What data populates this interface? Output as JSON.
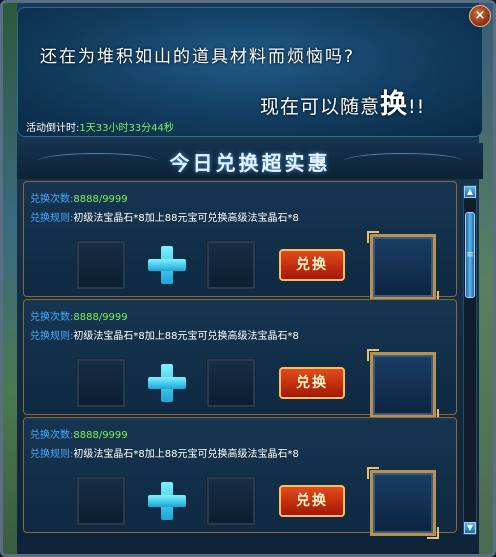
{
  "banner": {
    "line1": "还在为堆积如山的道具材料而烦恼吗?",
    "line2_prefix": "现在可以随意",
    "line2_big": "换",
    "line2_suffix": "!!",
    "timer_label": "活动倒计时:",
    "timer_value": "1天33小时33分44秒"
  },
  "close_label": "×",
  "section_title": "今日兑换超实惠",
  "items": [
    {
      "count_label": "兑换次数:",
      "count_value": "8888/9999",
      "rule_label": "兑换规则:",
      "rule_text": "初级法宝晶石*8加上88元宝可兑换高级法宝晶石*8",
      "button_label": "兑换"
    },
    {
      "count_label": "兑换次数:",
      "count_value": "8888/9999",
      "rule_label": "兑换规则:",
      "rule_text": "初级法宝晶石*8加上88元宝可兑换高级法宝晶石*8",
      "button_label": "兑换"
    },
    {
      "count_label": "兑换次数:",
      "count_value": "8888/9999",
      "rule_label": "兑换规则:",
      "rule_text": "初级法宝晶石*8加上88元宝可兑换高级法宝晶石*8",
      "button_label": "兑换"
    }
  ],
  "scrollbar": {
    "up_icon": "arrow-up-icon",
    "down_icon": "arrow-down-icon",
    "thumb_glyph": "≡"
  },
  "colors": {
    "key_text": "#4aa8ff",
    "value_text": "#7cf25a",
    "button": "#c82e10",
    "frame_gold": "#b89050"
  }
}
